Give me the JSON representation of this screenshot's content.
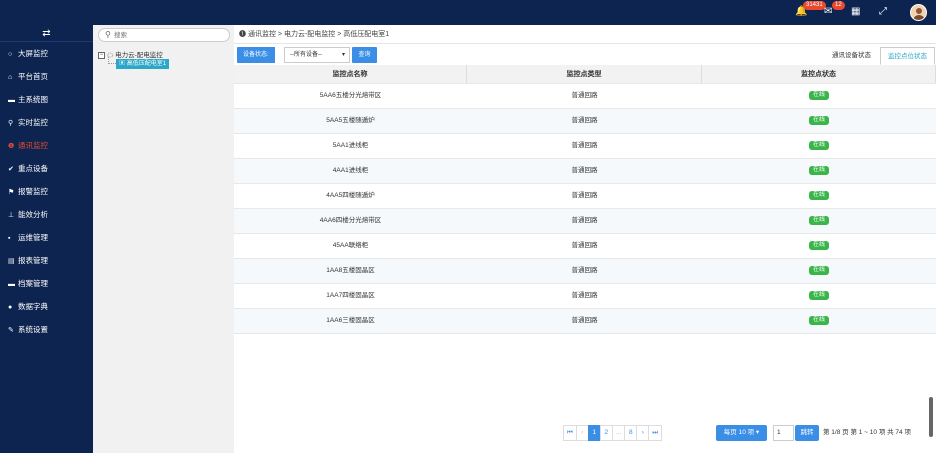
{
  "topbar": {
    "bell_badge": "31431",
    "mail_badge": "12",
    "icons": [
      "bell-icon",
      "mail-icon",
      "grid-icon",
      "fullscreen-icon"
    ]
  },
  "sidebar": {
    "toggle": "⇄",
    "items": [
      {
        "label": "大屏监控",
        "icon": "circle-icon"
      },
      {
        "label": "平台首页",
        "icon": "home-icon"
      },
      {
        "label": "主系统图",
        "icon": "screen-icon"
      },
      {
        "label": "实时监控",
        "icon": "pin-icon"
      },
      {
        "label": "通讯监控",
        "icon": "alert-icon",
        "active": true
      },
      {
        "label": "重点设备",
        "icon": "check-icon"
      },
      {
        "label": "报警监控",
        "icon": "flag-icon"
      },
      {
        "label": "能效分析",
        "icon": "pushpin-icon"
      },
      {
        "label": "运维管理",
        "icon": "briefcase-icon"
      },
      {
        "label": "报表管理",
        "icon": "file-icon"
      },
      {
        "label": "档案管理",
        "icon": "archive-icon"
      },
      {
        "label": "数据字典",
        "icon": "dot-icon"
      },
      {
        "label": "系统设置",
        "icon": "wrench-icon"
      }
    ]
  },
  "tree": {
    "search_placeholder": "搜索",
    "root": "电力云-配电监控",
    "child": "高低压配电室1"
  },
  "breadcrumb": {
    "items": [
      "通讯监控",
      "电力云-配电监控",
      "高低压配电室1"
    ],
    "sep": ">"
  },
  "toolbar": {
    "label": "设备状态:",
    "select_value": "--所有设备--",
    "query": "查询"
  },
  "tabs": [
    "通讯设备状态",
    "监控点位状态"
  ],
  "table": {
    "headers": [
      "监控点名称",
      "监控点类型",
      "监控点状态"
    ],
    "rows": [
      {
        "name": "5AA6五楼分光熔带区",
        "type": "普通回路",
        "status": "在线"
      },
      {
        "name": "5AA5五楼随遁炉",
        "type": "普通回路",
        "status": "在线"
      },
      {
        "name": "5AA1进线柜",
        "type": "普通回路",
        "status": "在线"
      },
      {
        "name": "4AA1进线柜",
        "type": "普通回路",
        "status": "在线"
      },
      {
        "name": "4AA5四楼随遁炉",
        "type": "普通回路",
        "status": "在线"
      },
      {
        "name": "4AA6四楼分光熔带区",
        "type": "普通回路",
        "status": "在线"
      },
      {
        "name": "45AA联络柜",
        "type": "普通回路",
        "status": "在线"
      },
      {
        "name": "1AA8五楼固晶区",
        "type": "普通回路",
        "status": "在线"
      },
      {
        "name": "1AA7四楼固晶区",
        "type": "普通回路",
        "status": "在线"
      },
      {
        "name": "1AA6三楼固晶区",
        "type": "普通回路",
        "status": "在线"
      }
    ]
  },
  "pager": {
    "first": "⏮",
    "prev": "‹",
    "pages": [
      "1",
      "2",
      "...",
      "8"
    ],
    "next": "›",
    "last": "⏭",
    "per_page": "每页 10 项 ▾",
    "goto_value": "1",
    "goto_btn": "跳转",
    "info": "第 1/8 页 第 1 ~ 10 项 共 74 项"
  }
}
